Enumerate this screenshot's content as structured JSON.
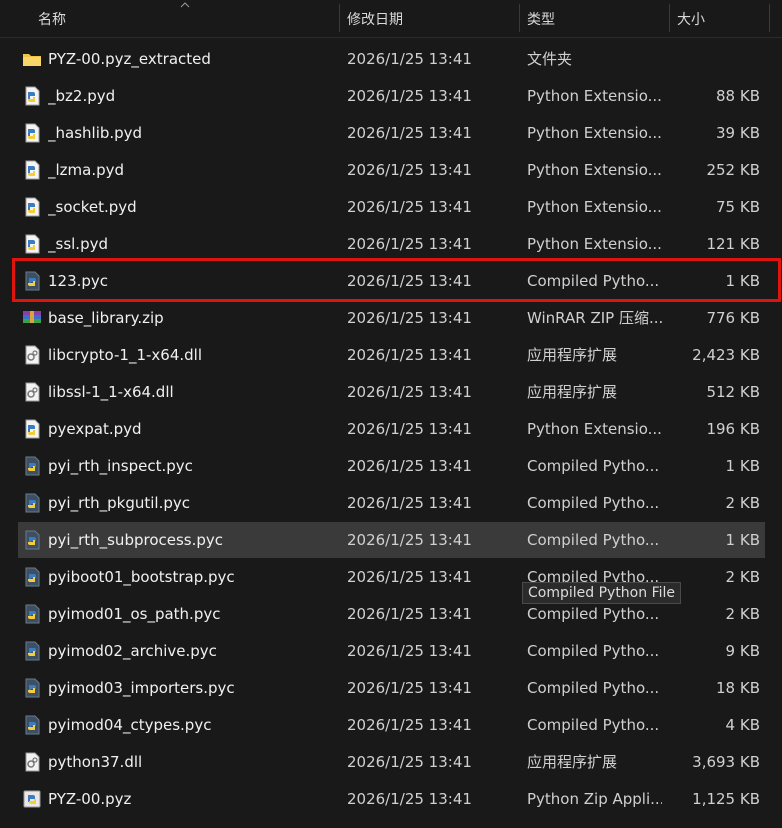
{
  "columns": {
    "name": "名称",
    "date": "修改日期",
    "type": "类型",
    "size": "大小"
  },
  "rows": [
    {
      "name": "PYZ-00.pyz_extracted",
      "date": "2026/1/25 13:41",
      "type": "文件夹",
      "size": "",
      "icon": "folder-icon"
    },
    {
      "name": "_bz2.pyd",
      "date": "2026/1/25 13:41",
      "type": "Python Extensio...",
      "size": "88 KB",
      "icon": "python-extension-icon"
    },
    {
      "name": "_hashlib.pyd",
      "date": "2026/1/25 13:41",
      "type": "Python Extensio...",
      "size": "39 KB",
      "icon": "python-extension-icon"
    },
    {
      "name": "_lzma.pyd",
      "date": "2026/1/25 13:41",
      "type": "Python Extensio...",
      "size": "252 KB",
      "icon": "python-extension-icon"
    },
    {
      "name": "_socket.pyd",
      "date": "2026/1/25 13:41",
      "type": "Python Extensio...",
      "size": "75 KB",
      "icon": "python-extension-icon"
    },
    {
      "name": "_ssl.pyd",
      "date": "2026/1/25 13:41",
      "type": "Python Extensio...",
      "size": "121 KB",
      "icon": "python-extension-icon"
    },
    {
      "name": "123.pyc",
      "date": "2026/1/25 13:41",
      "type": "Compiled Pytho...",
      "size": "1 KB",
      "icon": "python-compiled-icon"
    },
    {
      "name": "base_library.zip",
      "date": "2026/1/25 13:41",
      "type": "WinRAR ZIP 压缩...",
      "size": "776 KB",
      "icon": "winrar-archive-icon"
    },
    {
      "name": "libcrypto-1_1-x64.dll",
      "date": "2026/1/25 13:41",
      "type": "应用程序扩展",
      "size": "2,423 KB",
      "icon": "dll-file-icon"
    },
    {
      "name": "libssl-1_1-x64.dll",
      "date": "2026/1/25 13:41",
      "type": "应用程序扩展",
      "size": "512 KB",
      "icon": "dll-file-icon"
    },
    {
      "name": "pyexpat.pyd",
      "date": "2026/1/25 13:41",
      "type": "Python Extensio...",
      "size": "196 KB",
      "icon": "python-extension-icon"
    },
    {
      "name": "pyi_rth_inspect.pyc",
      "date": "2026/1/25 13:41",
      "type": "Compiled Pytho...",
      "size": "1 KB",
      "icon": "python-compiled-icon"
    },
    {
      "name": "pyi_rth_pkgutil.pyc",
      "date": "2026/1/25 13:41",
      "type": "Compiled Pytho...",
      "size": "2 KB",
      "icon": "python-compiled-icon"
    },
    {
      "name": "pyi_rth_subprocess.pyc",
      "date": "2026/1/25 13:41",
      "type": "Compiled Pytho...",
      "size": "1 KB",
      "icon": "python-compiled-icon"
    },
    {
      "name": "pyiboot01_bootstrap.pyc",
      "date": "2026/1/25 13:41",
      "type": "Compiled Pytho...",
      "size": "2 KB",
      "icon": "python-compiled-icon"
    },
    {
      "name": "pyimod01_os_path.pyc",
      "date": "2026/1/25 13:41",
      "type": "Compiled Pytho...",
      "size": "2 KB",
      "icon": "python-compiled-icon"
    },
    {
      "name": "pyimod02_archive.pyc",
      "date": "2026/1/25 13:41",
      "type": "Compiled Pytho...",
      "size": "9 KB",
      "icon": "python-compiled-icon"
    },
    {
      "name": "pyimod03_importers.pyc",
      "date": "2026/1/25 13:41",
      "type": "Compiled Pytho...",
      "size": "18 KB",
      "icon": "python-compiled-icon"
    },
    {
      "name": "pyimod04_ctypes.pyc",
      "date": "2026/1/25 13:41",
      "type": "Compiled Pytho...",
      "size": "4 KB",
      "icon": "python-compiled-icon"
    },
    {
      "name": "python37.dll",
      "date": "2026/1/25 13:41",
      "type": "应用程序扩展",
      "size": "3,693 KB",
      "icon": "dll-file-icon"
    },
    {
      "name": "PYZ-00.pyz",
      "date": "2026/1/25 13:41",
      "type": "Python Zip Appli...",
      "size": "1,125 KB",
      "icon": "python-zip-icon"
    }
  ],
  "tooltip": "Compiled Python File",
  "hovered_row": "pyi_rth_subprocess.pyc",
  "highlighted_row": "123.pyc",
  "colors": {
    "background": "#191919",
    "hover": "#3a3a3a",
    "highlight_border": "#e0140f"
  }
}
